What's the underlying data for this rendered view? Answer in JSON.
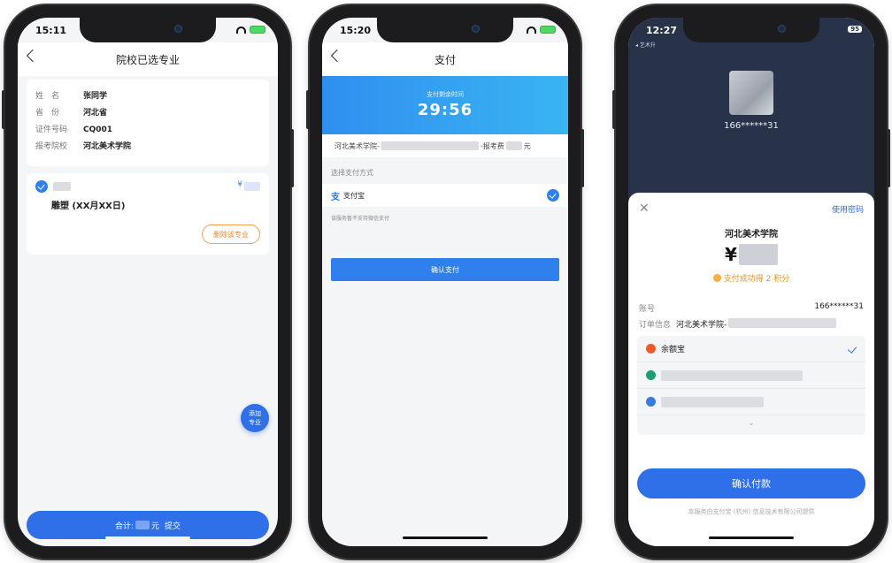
{
  "phone1": {
    "status_time": "15:11",
    "nav_title": "院校已选专业",
    "info": [
      {
        "key": "姓　名",
        "value": "张同学"
      },
      {
        "key": "省　份",
        "value": "河北省"
      },
      {
        "key": "证件号码",
        "value": "CQ001"
      },
      {
        "key": "报考院校",
        "value": "河北美术学院"
      }
    ],
    "major_name": "雕塑 (XX月XX日)",
    "price_symbol": "¥",
    "delete_label": "删除该专业",
    "fab_label_1": "添加",
    "fab_label_2": "专业",
    "total_label": "合计:",
    "total_unit": "元",
    "submit_label": "提交"
  },
  "phone2": {
    "status_time": "15:20",
    "nav_title": "支付",
    "countdown_label": "支付剩余时间",
    "countdown": "29:56",
    "order_prefix": "河北美术学院-",
    "order_fee_label": "-报考费",
    "order_unit": "元",
    "section_label": "选择支付方式",
    "method_logo": "支",
    "method_name": "支付宝",
    "note": "该服务暂不支持微信支付",
    "confirm_label": "确认支付"
  },
  "phone3": {
    "status_time": "12:27",
    "back_app": "◂ 艺术升",
    "battery": "95",
    "account_top": "166******31",
    "close_symbol": "✕",
    "use_password": "使用密码",
    "merchant": "河北美术学院",
    "yen": "¥",
    "reward": "支付成功得 2 积分",
    "account_label": "账号",
    "account_value": "166******31",
    "order_label": "订单信息",
    "order_value": "河北美术学院-",
    "method_1": "余额宝",
    "chevron": "⌄",
    "pay_label": "确认付款",
    "footer": "本服务由支付宝 (杭州) 信息技术有限公司提供"
  },
  "colors": {
    "accent": "#2f6fe8",
    "alipay": "#1677ff",
    "orange": "#e88a30",
    "dark_header": "#283349"
  }
}
